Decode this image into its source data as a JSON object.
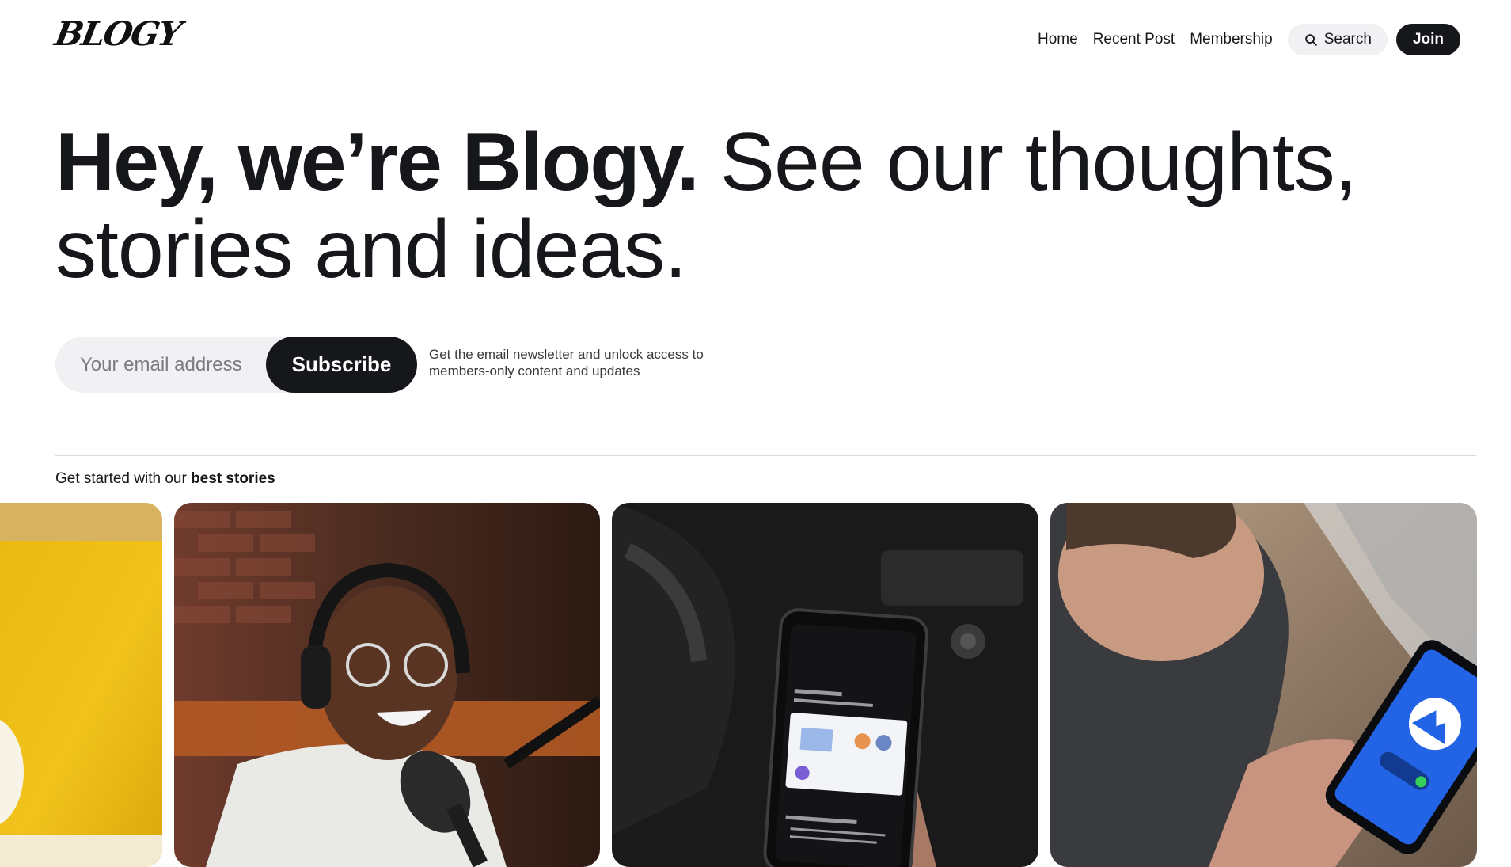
{
  "header": {
    "logo_text": "BLOGY",
    "nav": [
      {
        "label": "Home"
      },
      {
        "label": "Recent Post"
      },
      {
        "label": "Membership"
      }
    ],
    "search_label": "Search",
    "join_label": "Join"
  },
  "hero": {
    "bold_text": "Hey, we’re Blogy.",
    "light_text": "See our thoughts, stories and ideas."
  },
  "subscribe": {
    "email_placeholder": "Your email address",
    "button_label": "Subscribe",
    "note": "Get the email newsletter and unlock access to members-only content and updates"
  },
  "best_stories": {
    "prefix": "Get started with our",
    "emphasis": "best stories",
    "cards": [
      {
        "image": "yellow-desk-photo"
      },
      {
        "image": "podcaster-with-headphones-photo"
      },
      {
        "image": "phone-in-car-photo"
      },
      {
        "image": "vpn-app-on-phone-photo"
      }
    ]
  },
  "colors": {
    "primary_dark": "#15171a",
    "pill_background": "#f1f1f3",
    "divider": "#d9d9dc"
  }
}
